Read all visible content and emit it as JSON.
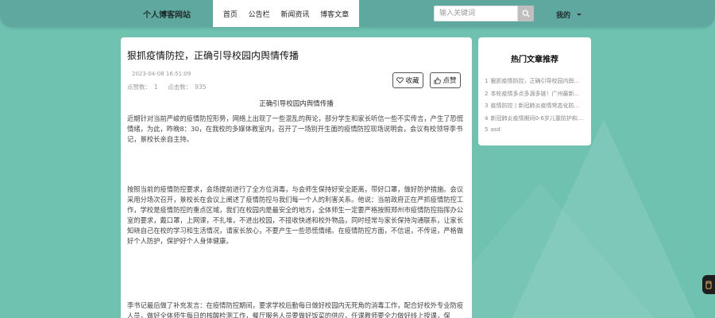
{
  "nav": {
    "brand": "个人博客网站",
    "tabs": [
      {
        "label": "首页"
      },
      {
        "label": "公告栏"
      },
      {
        "label": "新闻资讯"
      },
      {
        "label": "博客文章"
      }
    ],
    "search_placeholder": "输入关键词",
    "my_label": "我的"
  },
  "article": {
    "title": "狠抓疫情防控，正确引导校园内舆情传播",
    "date": "2023-04-08 16:51:09",
    "likes_label": "点赞数：",
    "likes_value": "1",
    "clicks_label": "点击数：",
    "clicks_value": "935",
    "favorite_label": "收藏",
    "like_label": "点赞",
    "subtitle": "正确引导校园内舆情传播",
    "paragraphs": [
      "近期针对当前严峻的疫情防控形势，网络上出现了一些混乱的舆论，部分学生和家长听信一些不实传言，产生了恐慌情绪，为此，昨晚8：30，在我校的多媒体教室内，召开了一场别开生面的疫情防控现场说明会，会议有校领导李书记，景校长亲自主持。",
      "按照当前的疫情防控要求，会场提前进行了全方位消毒，与会师生保持好安全距离，带好口罩，做好防护措施。会议采用分场次召开，景校长在会议上阐述了疫情防控与我们每一个人的利害关系。他说：当前政府正在严抓疫情防控工作，学校是疫情防控的重点区域，我们在校园内是最安全的地方，全体师生一定要严格按照郑州市疫情防控指挥办公室的要求，戴口罩，上网课，不扎堆，不进出校园，不接收快递和校外物品，同时经常与家长保持沟通联系，让家长知晓自己在校的学习和生活情况，请家长放心，不要产生一些恐慌情绪。在疫情防控方面，不信谣，不传谣，严格做好个人防护，保护好个人身体健康。",
      "李书记最后做了补充发言：在疫情防控期间，要求学校后勤每日做好校园内无死角的消毒工作，配合好校外专业防疫人员，做好全体师生每日的核酸检测工作，餐厅服务人员要做好饭菜的供应，任课教师要全力做好线上授课，保"
    ]
  },
  "sidebar": {
    "title": "热门文章推荐",
    "items": [
      {
        "num": "1",
        "text": "狠抓疫情防控，正确引导校园内舆..."
      },
      {
        "num": "2",
        "text": "本轮疫情多点多源多链！广州最新..."
      },
      {
        "num": "3",
        "text": "疫情防控丨新冠肺炎疫情常态化防..."
      },
      {
        "num": "4",
        "text": "新冠肺炎疫情期间0-6岁儿童防护和..."
      },
      {
        "num": "5",
        "text": "asd"
      }
    ]
  },
  "colors": {
    "background": "#6fc2b0",
    "navbar": "#5fa8a0"
  }
}
